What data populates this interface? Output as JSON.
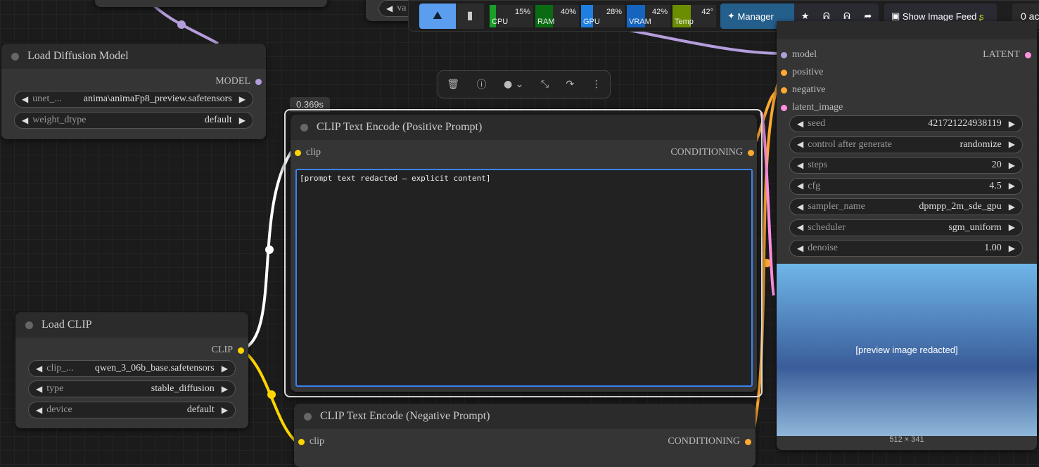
{
  "topbar": {
    "monitors": [
      {
        "name": "CPU",
        "value": "15%",
        "pct": 15,
        "color": "#1a9e2a"
      },
      {
        "name": "RAM",
        "value": "40%",
        "pct": 40,
        "color": "#0b6b12"
      },
      {
        "name": "GPU",
        "value": "28%",
        "pct": 28,
        "color": "#1e7fe0"
      },
      {
        "name": "VRAM",
        "value": "42%",
        "pct": 42,
        "color": "#1565c0"
      },
      {
        "name": "Temp",
        "value": "42°",
        "pct": 42,
        "color": "#6b8e00"
      }
    ],
    "manager": "Manager",
    "image_feed": "Show Image Feed",
    "queue": "0 ac",
    "hidden_widget": "va"
  },
  "load_diffusion": {
    "title": "Load Diffusion Model",
    "output": "MODEL",
    "widgets": [
      {
        "label": "unet_...",
        "value": "anima\\animaFp8_preview.safetensors"
      },
      {
        "label": "weight_dtype",
        "value": "default"
      }
    ]
  },
  "load_clip": {
    "title": "Load CLIP",
    "output": "CLIP",
    "widgets": [
      {
        "label": "clip_...",
        "value": "qwen_3_06b_base.safetensors"
      },
      {
        "label": "type",
        "value": "stable_diffusion"
      },
      {
        "label": "device",
        "value": "default"
      }
    ]
  },
  "positive": {
    "time": "0.369s",
    "title": "CLIP Text Encode (Positive Prompt)",
    "input": "clip",
    "output": "CONDITIONING",
    "text": "[prompt text redacted — explicit content]"
  },
  "negative": {
    "title": "CLIP Text Encode (Negative Prompt)",
    "input": "clip",
    "output": "CONDITIONING"
  },
  "ksampler": {
    "inputs": [
      "model",
      "positive",
      "negative",
      "latent_image"
    ],
    "output": "LATENT",
    "widgets": [
      {
        "label": "seed",
        "value": "421721224938119"
      },
      {
        "label": "control after generate",
        "value": "randomize"
      },
      {
        "label": "steps",
        "value": "20"
      },
      {
        "label": "cfg",
        "value": "4.5"
      },
      {
        "label": "sampler_name",
        "value": "dpmpp_2m_sde_gpu"
      },
      {
        "label": "scheduler",
        "value": "sgm_uniform"
      },
      {
        "label": "denoise",
        "value": "1.00"
      }
    ],
    "preview_label": "[preview image redacted]",
    "image_size": "512 × 341"
  }
}
